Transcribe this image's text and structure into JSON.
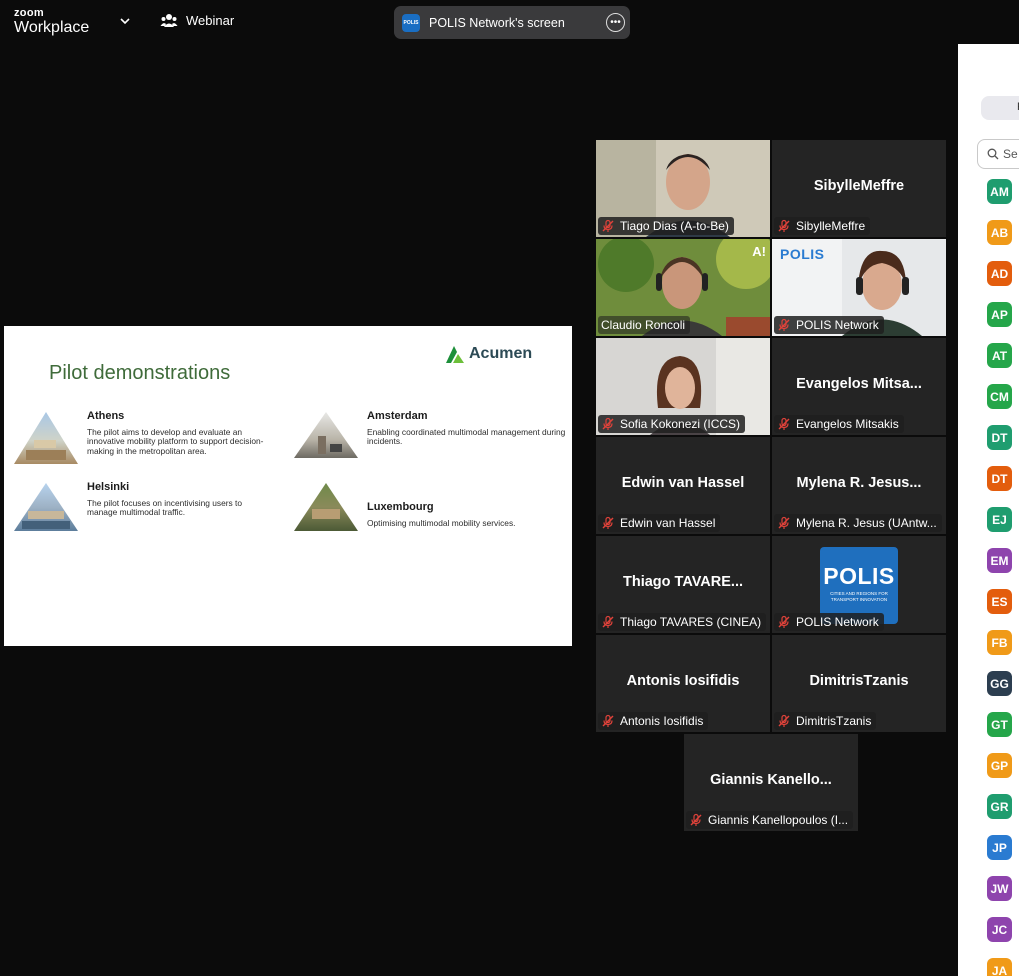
{
  "app": {
    "brand_small": "zoom",
    "brand_large": "Workplace",
    "mode_label": "Webinar"
  },
  "screen_share": {
    "label": "POLIS Network's screen",
    "logo_text": "POLIS"
  },
  "slide": {
    "title": "Pilot demonstrations",
    "logo": "Acumen",
    "cities": [
      {
        "name": "Athens",
        "desc": "The pilot aims to develop and evaluate an innovative mobility platform to support decision-making in the metropolitan area."
      },
      {
        "name": "Amsterdam",
        "desc": "Enabling coordinated multimodal management during incidents."
      },
      {
        "name": "Helsinki",
        "desc": "The pilot focuses on incentivising users to manage multimodal traffic."
      },
      {
        "name": "Luxembourg",
        "desc": "Optimising multimodal mobility services."
      }
    ]
  },
  "participants": [
    {
      "big": "",
      "name": "Tiago Dias (A-to-Be)"
    },
    {
      "big": "SibylleMeffre",
      "name": "SibylleMeffre"
    },
    {
      "big": "",
      "name": "Claudio Roncoli",
      "badge": "A!"
    },
    {
      "big": "",
      "name": "POLIS Network",
      "logo": "POLIS"
    },
    {
      "big": "",
      "name": "Sofia Kokonezi (ICCS)"
    },
    {
      "big": "Evangelos  Mitsa...",
      "name": "Evangelos Mitsakis"
    },
    {
      "big": "Edwin van Hassel",
      "name": "Edwin van Hassel"
    },
    {
      "big": "Mylena  R.  Jesus...",
      "name": "Mylena R. Jesus (UAntw..."
    },
    {
      "big": "Thiago  TAVARE...",
      "name": "Thiago TAVARES (CINEA)"
    },
    {
      "big": "",
      "name": "POLIS Network",
      "logo_big": "POLIS",
      "logo_sub": "CITIES AND REGIONS FOR TRANSPORT INNOVATION"
    },
    {
      "big": "Antonis Iosifidis",
      "name": "Antonis Iosifidis"
    },
    {
      "big": "DimitrisTzanis",
      "name": "DimitrisTzanis"
    },
    {
      "big": "Giannis  Kanello...",
      "name": "Giannis Kanellopoulos (I..."
    }
  ],
  "panel": {
    "pill_text": "P",
    "search_placeholder": "Se",
    "avatars": [
      {
        "initials": "AM",
        "color": "#1f9d6f"
      },
      {
        "initials": "AB",
        "color": "#f09a18"
      },
      {
        "initials": "AD",
        "color": "#e35d0d"
      },
      {
        "initials": "AP",
        "color": "#25a64a"
      },
      {
        "initials": "AT",
        "color": "#25a64a"
      },
      {
        "initials": "CM",
        "color": "#25a64a"
      },
      {
        "initials": "DT",
        "color": "#1f9d6f"
      },
      {
        "initials": "DT",
        "color": "#e35d0d"
      },
      {
        "initials": "EJ",
        "color": "#1f9d6f"
      },
      {
        "initials": "EM",
        "color": "#8e44ad"
      },
      {
        "initials": "ES",
        "color": "#e35d0d"
      },
      {
        "initials": "FB",
        "color": "#f09a18"
      },
      {
        "initials": "GG",
        "color": "#2c3e50"
      },
      {
        "initials": "GT",
        "color": "#25a64a"
      },
      {
        "initials": "GP",
        "color": "#f09a18"
      },
      {
        "initials": "GR",
        "color": "#1f9d6f"
      },
      {
        "initials": "JP",
        "color": "#2a7bd1"
      },
      {
        "initials": "JW",
        "color": "#8e44ad"
      },
      {
        "initials": "JC",
        "color": "#8e44ad"
      },
      {
        "initials": "JA",
        "color": "#f09a18"
      }
    ]
  },
  "colors": {
    "active_speaker": "#2ecc71",
    "mic_muted": "#e0423a",
    "tile_bg": "#242424"
  }
}
